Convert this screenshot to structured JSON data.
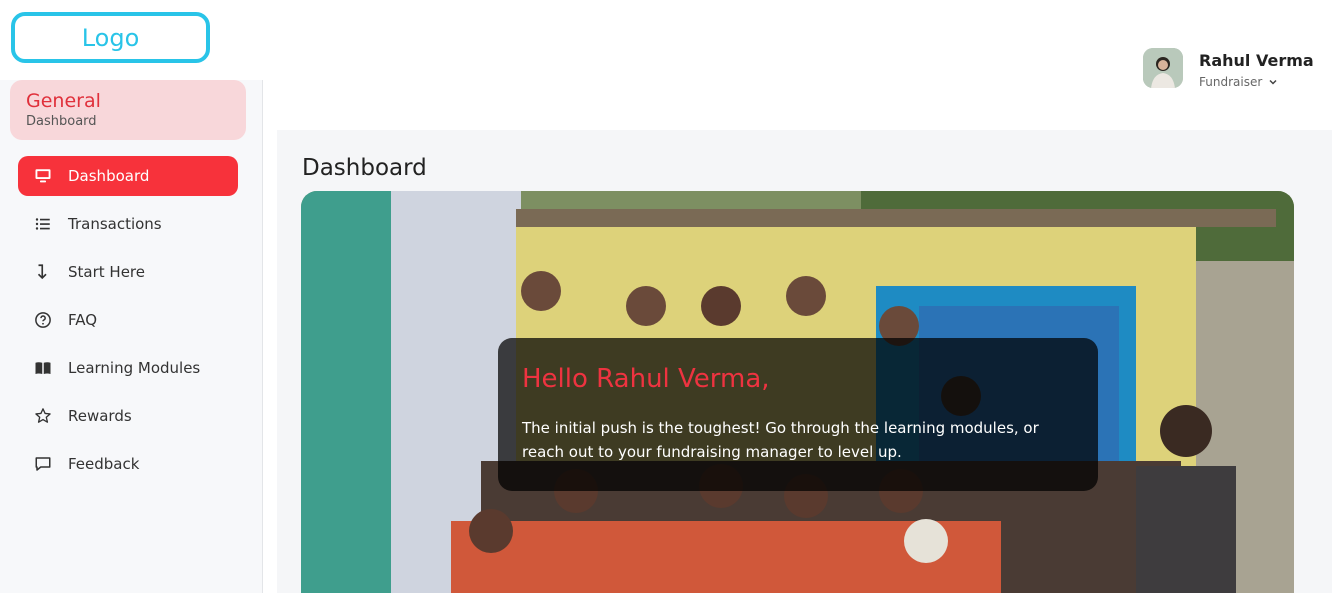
{
  "sidebar": {
    "logo": "Logo",
    "section": {
      "title": "General",
      "subtitle": "Dashboard"
    },
    "items": [
      {
        "label": "Dashboard",
        "icon": "monitor-icon",
        "active": true
      },
      {
        "label": "Transactions",
        "icon": "list-icon",
        "active": false
      },
      {
        "label": "Start Here",
        "icon": "arrow-down-turn-icon",
        "active": false
      },
      {
        "label": "FAQ",
        "icon": "question-circle-icon",
        "active": false
      },
      {
        "label": "Learning Modules",
        "icon": "book-icon",
        "active": false
      },
      {
        "label": "Rewards",
        "icon": "star-icon",
        "active": false
      },
      {
        "label": "Feedback",
        "icon": "message-square-icon",
        "active": false
      }
    ]
  },
  "header": {
    "user": {
      "name": "Rahul Verma",
      "role": "Fundraiser"
    }
  },
  "main": {
    "title": "Dashboard",
    "welcome": {
      "title": "Hello Rahul Verma,",
      "text": "The initial push is the toughest! Go through the learning modules, or reach out to your fundraising manager to level up."
    }
  },
  "colors": {
    "accent": "#f7323b",
    "logo": "#29c4e8",
    "section_bg": "#f8d7da",
    "welcome_title": "#ee3340"
  }
}
